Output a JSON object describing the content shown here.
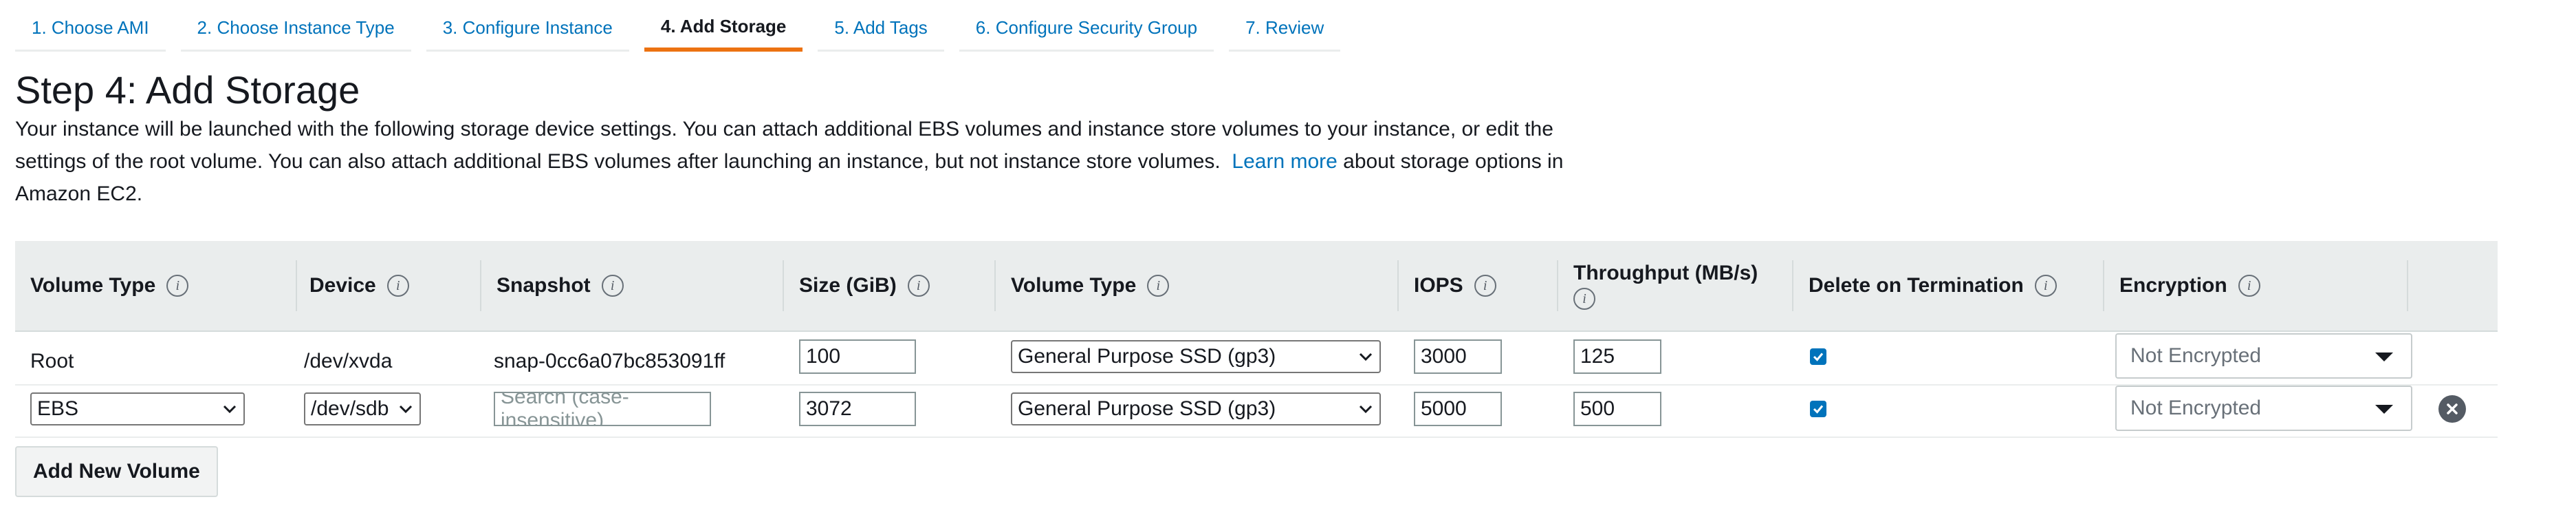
{
  "wizard": {
    "steps": [
      {
        "label": "1. Choose AMI"
      },
      {
        "label": "2. Choose Instance Type"
      },
      {
        "label": "3. Configure Instance"
      },
      {
        "label": "4. Add Storage"
      },
      {
        "label": "5. Add Tags"
      },
      {
        "label": "6. Configure Security Group"
      },
      {
        "label": "7. Review"
      }
    ],
    "active_step": "4. Add Storage"
  },
  "page": {
    "title": "Step 4: Add Storage",
    "description_before_link": "Your instance will be launched with the following storage device settings. You can attach additional EBS volumes and instance store volumes to your instance, or edit the settings of the root volume. You can also attach additional EBS volumes after launching an instance, but not instance store volumes.",
    "learn_more_link": "Learn more",
    "description_after_link": "about storage options in Amazon EC2."
  },
  "table": {
    "columns": [
      "Volume Type",
      "Device",
      "Snapshot",
      "Size (GiB)",
      "Volume Type",
      "IOPS",
      "Throughput (MB/s)",
      "Delete on Termination",
      "Encryption"
    ],
    "rows": [
      {
        "volume_type": "Root",
        "device": "/dev/xvda",
        "snapshot": "snap-0cc6a07bc853091ff",
        "size": "100",
        "ebs_volume_type": "General Purpose SSD (gp3)",
        "iops": "3000",
        "throughput": "125",
        "delete_on_termination": true,
        "encryption": "Not Encrypted"
      },
      {
        "volume_type": "EBS",
        "device": "/dev/sdb",
        "snapshot_placeholder": "Search (case-insensitive)",
        "size": "3072",
        "ebs_volume_type": "General Purpose SSD (gp3)",
        "iops": "5000",
        "throughput": "500",
        "delete_on_termination": true,
        "encryption": "Not Encrypted"
      }
    ]
  },
  "actions": {
    "add_volume_label": "Add New Volume"
  },
  "colors": {
    "link": "#0073bb",
    "active_tab_underline": "#ec7211",
    "header_bg": "#eaeded",
    "checkbox": "#0073bb"
  },
  "icons": {
    "info": "info-icon",
    "remove": "close-circle-icon",
    "select_arrow": "chevron-down-icon"
  }
}
